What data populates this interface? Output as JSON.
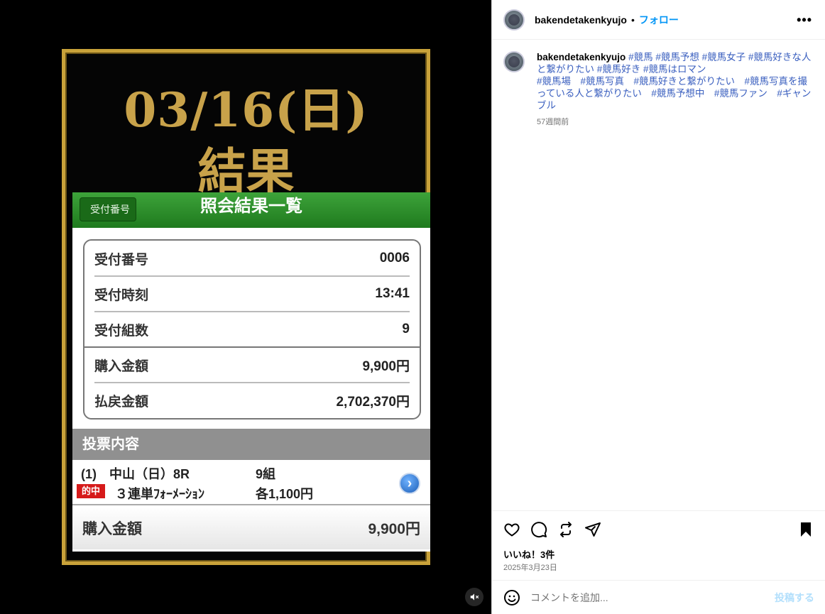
{
  "media": {
    "poster_date": "03/16(日)",
    "poster_result": "結果",
    "phone": {
      "back_label": "受付番号",
      "title": "照会結果一覧",
      "rows": [
        {
          "label": "受付番号",
          "value": "0006"
        },
        {
          "label": "受付時刻",
          "value": "13:41"
        },
        {
          "label": "受付組数",
          "value": "9"
        },
        {
          "label": "購入金額",
          "value": "9,900円"
        },
        {
          "label": "払戻金額",
          "value": "2,702,370円"
        }
      ],
      "section_label": "投票内容",
      "bet": {
        "line1_left": "(1)　中山（日）8R",
        "line1_right": "9組",
        "badge": "的中",
        "line2_left": "３連単ﾌｫｰﾒｰｼｮﾝ",
        "line2_right": "各1,100円"
      },
      "total_label": "購入金額",
      "total_value": "9,900円"
    },
    "mute_icon": "speaker-muted-icon"
  },
  "side": {
    "username": "bakendetakenkyujo",
    "dot": "•",
    "follow_label": "フォロー",
    "more_icon": "•••",
    "caption_user": "bakendetakenkyujo",
    "caption_tags": "#競馬 #競馬予想 #競馬女子 #競馬好きな人と繋がりたい #競馬好き #競馬はロマン\n#競馬場　#競馬写真　#競馬好きと繋がりたい　#競馬写真を撮っている人と繋がりたい　#競馬予想中　#競馬ファン　#ギャンブル",
    "time_ago": "57週間前",
    "likes": "いいね！3件",
    "date": "2025年3月23日",
    "comment_placeholder": "コメントを追加...",
    "post_label": "投稿する"
  }
}
